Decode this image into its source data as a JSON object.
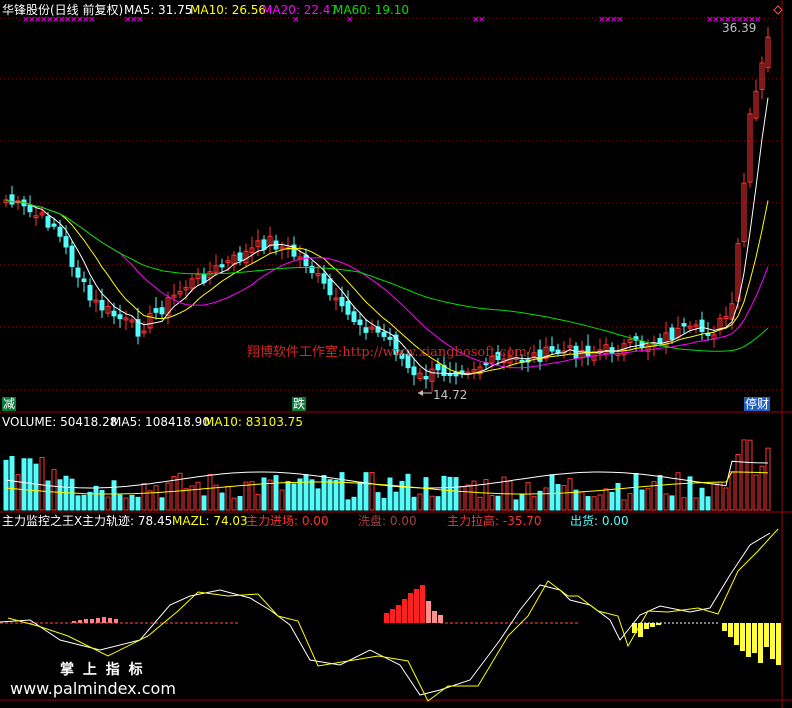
{
  "price_panel": {
    "title": "华锋股份(日线 前复权)",
    "ma5": "MA5: 31.75",
    "ma10": "MA10: 26.56",
    "ma20": "MA20: 22.47",
    "ma60": "MA60: 19.10",
    "high_label": "36.39",
    "low_label": "14.72",
    "watermark": "翔博软件工作室:http://www.xiangbosoft.com/",
    "badge_left": "减",
    "badge_mid": "跌",
    "badge_right": "停财"
  },
  "volume_panel": {
    "volume": "VOLUME: 50418.28",
    "ma5": "MA5: 108418.90",
    "ma10": "MA10: 83103.75"
  },
  "indicator_panel": {
    "name": "主力监控之王X",
    "track": "主力轨迹: 78.45",
    "mazl": "MAZL: 74.03",
    "enter": "主力进场: 0.00",
    "wash": "洗盘: 0.00",
    "pull": "主力拉高: -35.70",
    "ship": "出货: 0.00"
  },
  "footer": {
    "brand": "掌 上 指 标",
    "site": "www.palmindex.com"
  },
  "colors": {
    "up": "#ff3232",
    "down": "#54fcfc",
    "ma5": "#ffffff",
    "ma10": "#ffff00",
    "ma20": "#ff00ff",
    "ma60": "#00e000",
    "grid": "#a00000"
  }
}
